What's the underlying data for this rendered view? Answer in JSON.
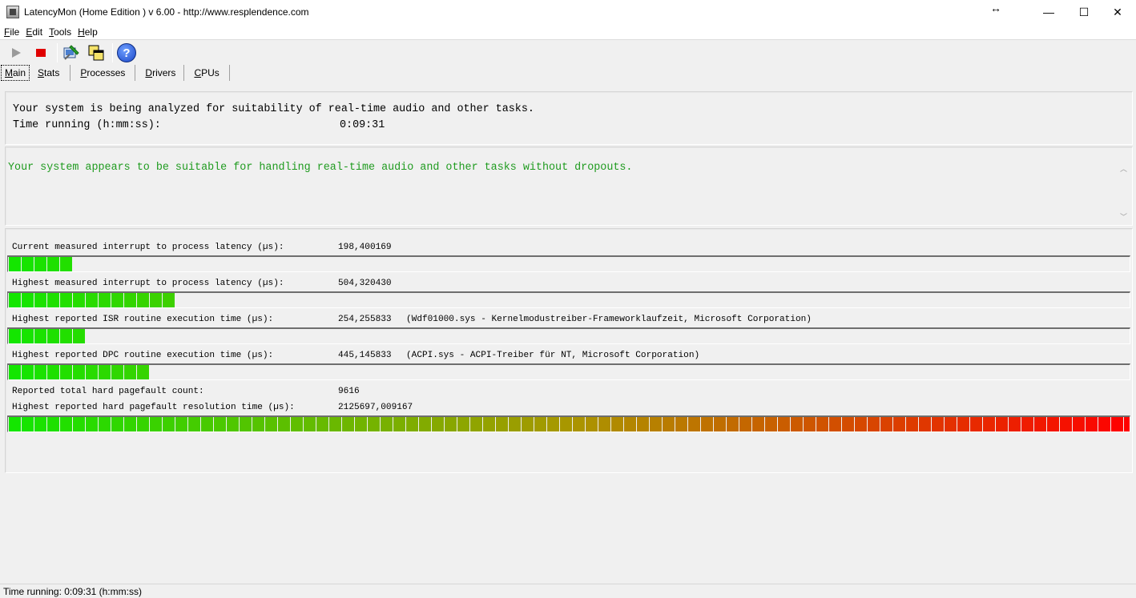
{
  "window": {
    "title": "LatencyMon  (Home Edition )  v 6.00 - http://www.resplendence.com",
    "resize_glyph": "↔",
    "minimize_glyph": "—",
    "maximize_glyph": "☐",
    "close_glyph": "✕"
  },
  "menu": {
    "items": [
      {
        "ul": "F",
        "rest": "ile"
      },
      {
        "ul": "E",
        "rest": "dit"
      },
      {
        "ul": "T",
        "rest": "ools"
      },
      {
        "ul": "H",
        "rest": "elp"
      }
    ]
  },
  "toolbar": {
    "help_glyph": "?"
  },
  "tabs": [
    {
      "ul": "M",
      "rest": "ain"
    },
    {
      "ul": "S",
      "rest": "tats"
    },
    {
      "ul": "P",
      "rest": "rocesses"
    },
    {
      "ul": "D",
      "rest": "rivers"
    },
    {
      "ul": "C",
      "rest": "PUs"
    }
  ],
  "summary": {
    "analyzing_text": "Your system is being analyzed for suitability of real-time audio and other tasks.",
    "time_label": "Time running (h:mm:ss):",
    "time_value": "0:09:31"
  },
  "verdict": {
    "message": "Your system appears to be suitable for handling real-time audio and other tasks without dropouts.",
    "color": "#1f9b1f"
  },
  "stats": {
    "current_latency": {
      "label": "Current measured interrupt to process latency (µs):",
      "value": "198,400169",
      "filled_segments": 5
    },
    "highest_latency": {
      "label": "Highest measured interrupt to process latency (µs):",
      "value": "504,320430",
      "filled_segments": 13
    },
    "isr": {
      "label": "Highest reported ISR routine execution time (µs):",
      "value": "254,255833",
      "extra": "(Wdf01000.sys - Kernelmodustreiber-Frameworklaufzeit, Microsoft Corporation)",
      "filled_segments": 6
    },
    "dpc": {
      "label": "Highest reported DPC routine execution time (µs):",
      "value": "445,145833",
      "extra": "(ACPI.sys - ACPI-Treiber für NT, Microsoft Corporation)",
      "filled_segments": 11
    },
    "pagefault_count": {
      "label": "Reported total hard pagefault count:",
      "value": "9616"
    },
    "pagefault_time": {
      "label": "Highest reported hard pagefault resolution time (µs):",
      "value": "2125697,009167",
      "filled_segments": 88
    }
  },
  "status_bar": {
    "text": "Time running: 0:09:31  (h:mm:ss)"
  }
}
